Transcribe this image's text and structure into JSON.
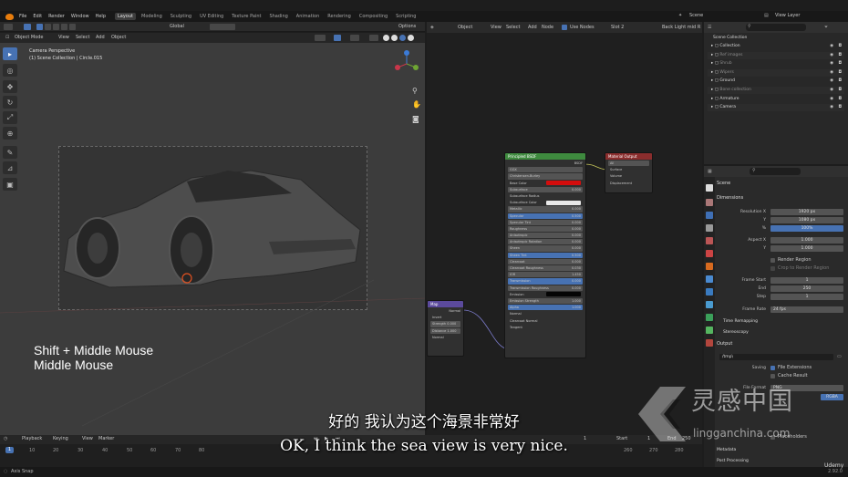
{
  "menubar": {
    "menus": [
      "File",
      "Edit",
      "Render",
      "Window",
      "Help"
    ],
    "workspaces": [
      "Layout",
      "Modeling",
      "Sculpting",
      "UV Editing",
      "Texture Paint",
      "Shading",
      "Animation",
      "Rendering",
      "Compositing",
      "Scripting"
    ],
    "active_workspace": "Layout",
    "scene": "Scene",
    "view_layer": "View Layer"
  },
  "viewport": {
    "mode": "Object Mode",
    "menus": [
      "View",
      "Select",
      "Add",
      "Object"
    ],
    "transform": "Global",
    "options": "Options",
    "info_line1": "Camera Perspective",
    "info_line2": "(1) Scene Collection | Circle.015",
    "shortcut_line1": "Shift + Middle Mouse",
    "shortcut_line2": "Middle Mouse",
    "bg_color": "#3c3c3c"
  },
  "node_editor": {
    "editor": "Object",
    "menus": [
      "View",
      "Select",
      "Add",
      "Node"
    ],
    "use_nodes": "Use Nodes",
    "slot": "Slot 2",
    "material": "Back Light mid R",
    "principled": {
      "title": "Principled BSDF",
      "output": "BSDF",
      "distribution": "GGX",
      "subsurface_method": "Christensen-Burley",
      "rows": [
        {
          "label": "Base Color",
          "value": "",
          "type": "red"
        },
        {
          "label": "Subsurface",
          "value": "0.000",
          "type": "f"
        },
        {
          "label": "Subsurface Radius",
          "value": "",
          "type": "l"
        },
        {
          "label": "Subsurface Color",
          "value": "",
          "type": "white"
        },
        {
          "label": "Metallic",
          "value": "0.000",
          "type": "f"
        },
        {
          "label": "Specular",
          "value": "0.500",
          "type": "b"
        },
        {
          "label": "Specular Tint",
          "value": "0.000",
          "type": "f"
        },
        {
          "label": "Roughness",
          "value": "0.000",
          "type": "f"
        },
        {
          "label": "Anisotropic",
          "value": "0.000",
          "type": "f"
        },
        {
          "label": "Anisotropic Rotation",
          "value": "0.000",
          "type": "f"
        },
        {
          "label": "Sheen",
          "value": "0.000",
          "type": "f"
        },
        {
          "label": "Sheen Tint",
          "value": "0.500",
          "type": "b"
        },
        {
          "label": "Clearcoat",
          "value": "0.000",
          "type": "f"
        },
        {
          "label": "Clearcoat Roughness",
          "value": "0.030",
          "type": "f"
        },
        {
          "label": "IOR",
          "value": "1.450",
          "type": "f"
        },
        {
          "label": "Transmission",
          "value": "0.000",
          "type": "b"
        },
        {
          "label": "Transmission Roughness",
          "value": "0.000",
          "type": "f"
        },
        {
          "label": "Emission",
          "value": "",
          "type": "black"
        },
        {
          "label": "Emission Strength",
          "value": "1.000",
          "type": "f"
        },
        {
          "label": "Alpha",
          "value": "1.000",
          "type": "b"
        },
        {
          "label": "Normal",
          "value": "",
          "type": "l"
        },
        {
          "label": "Clearcoat Normal",
          "value": "",
          "type": "l"
        },
        {
          "label": "Tangent",
          "value": "",
          "type": "l"
        }
      ]
    },
    "material_output": {
      "title": "Material Output",
      "target": "All",
      "sockets": [
        "Surface",
        "Volume",
        "Displacement"
      ]
    },
    "normal_node": {
      "title": "Map",
      "output": "Normal",
      "rows": [
        "Invert",
        "Strength 0.000",
        "Distance 1.000",
        "Normal"
      ]
    }
  },
  "outliner": {
    "title": "Scene Collection",
    "items": [
      "Collection",
      "Ref images",
      "Shrub",
      "Wipers",
      "Ground",
      "Bone collection",
      "Armature",
      "Camera"
    ]
  },
  "properties": {
    "scene": "Scene",
    "dimensions_title": "Dimensions",
    "resolution_x_label": "Resolution X",
    "resolution_x": "1920 px",
    "resolution_y_label": "Y",
    "resolution_y": "1080 px",
    "percent_label": "%",
    "percent": "100%",
    "aspect_x_label": "Aspect X",
    "aspect_x": "1.000",
    "aspect_y_label": "Y",
    "aspect_y": "1.000",
    "render_region": "Render Region",
    "crop_region": "Crop to Render Region",
    "frame_start_label": "Frame Start",
    "frame_start": "1",
    "end_label": "End",
    "end": "250",
    "step_label": "Step",
    "step": "1",
    "frame_rate_label": "Frame Rate",
    "frame_rate": "24 fps",
    "time_remapping": "Time Remapping",
    "stereoscopy": "Stereoscopy",
    "output_title": "Output",
    "output_path": "/tmp\\",
    "saving_label": "Saving",
    "file_extensions": "File Extensions",
    "cache_result": "Cache Result",
    "file_format_label": "File Format",
    "file_format": "PNG",
    "color_rgba": "RGBA",
    "placeholders": "Placeholders",
    "metadata": "Metadata",
    "post_processing": "Post Processing"
  },
  "timeline": {
    "menus": [
      "Playback",
      "Keying",
      "View",
      "Marker"
    ],
    "start_label": "Start",
    "start": "1",
    "end_label": "End",
    "end": "250",
    "current_frame": "1",
    "ticks": [
      "10",
      "20",
      "30",
      "40",
      "50",
      "60",
      "70",
      "80",
      "260",
      "270",
      "280"
    ]
  },
  "status": {
    "left": "Axis Snap",
    "right": "2.92.0"
  },
  "subtitles": {
    "chinese": "好的 我认为这个海景非常好",
    "english": "OK, I think the sea view is very nice."
  },
  "watermark": {
    "brand": "灵感中国",
    "url": "lingganchina.com",
    "corner": "Udemy"
  }
}
